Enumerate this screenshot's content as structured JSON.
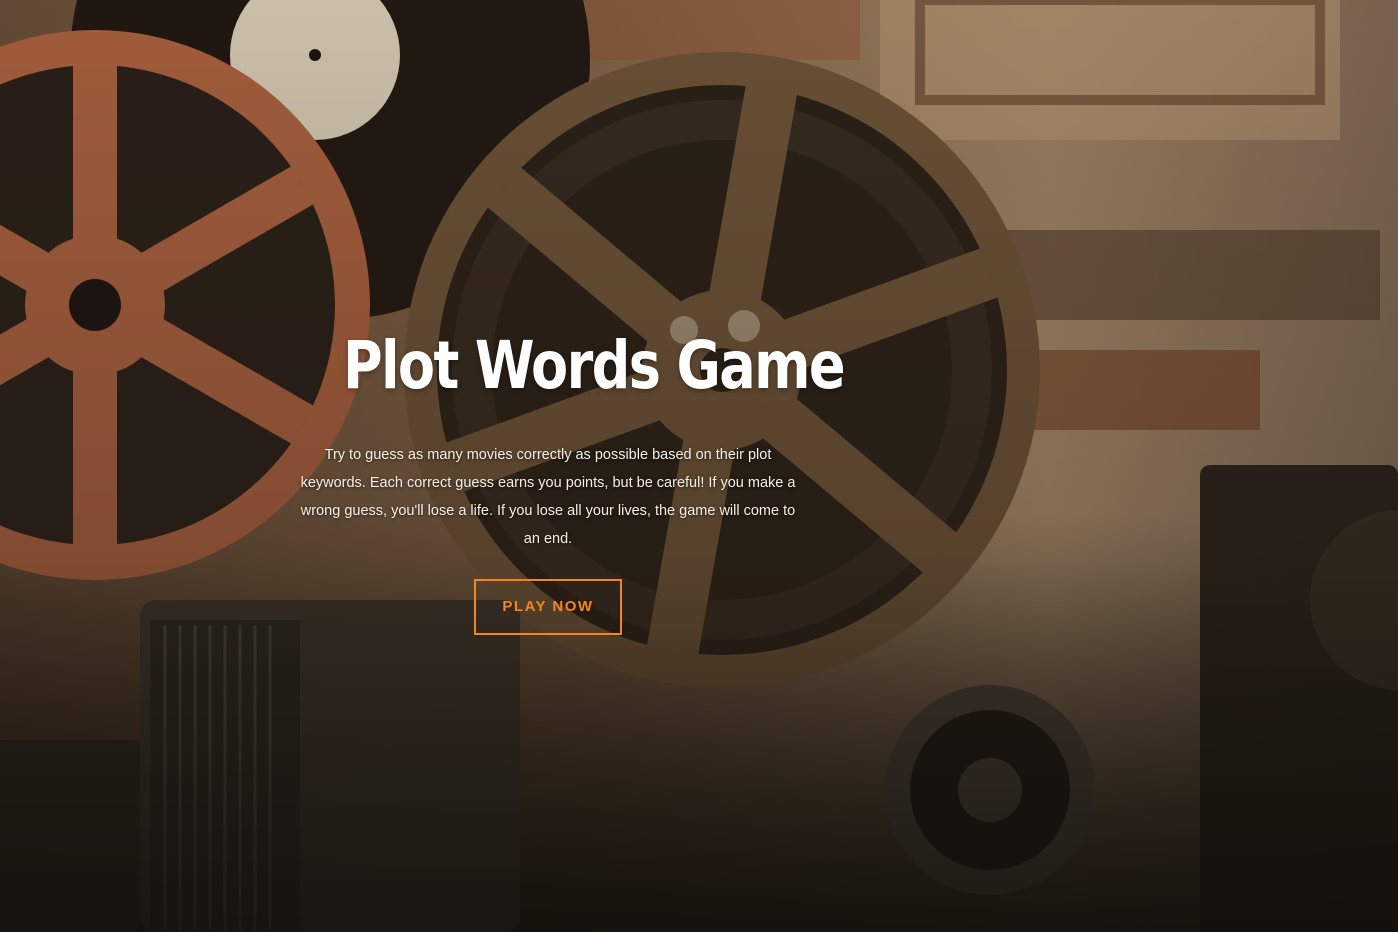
{
  "hero": {
    "title": "Plot Words Game",
    "description": "Try to guess as many movies correctly as possible based on their plot keywords. Each correct guess earns you points, but be careful! If you make a wrong guess, you'll lose a life. If you lose all your lives, the game will come to an end.",
    "play_button_label": "PLAY NOW"
  },
  "colors": {
    "accent": "#f3861f",
    "title": "#ffffff",
    "text": "#f4efe8"
  }
}
